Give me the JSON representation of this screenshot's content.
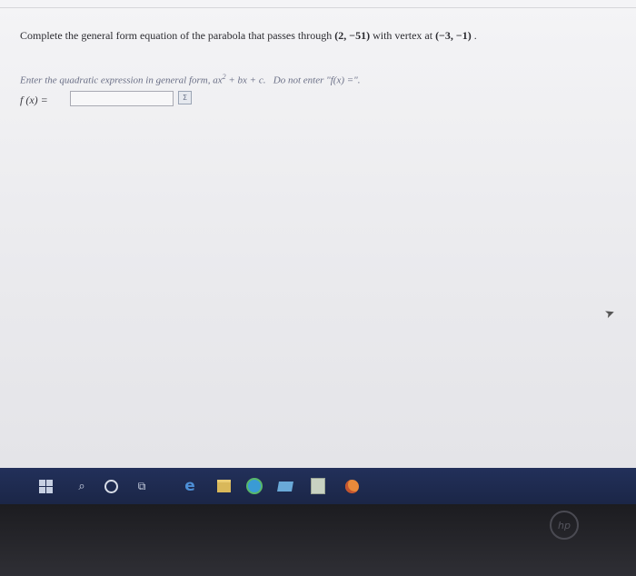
{
  "question": {
    "prefix": "Complete the general form equation of the parabola that passes through",
    "point": "(2, −51)",
    "middle": "with vertex at",
    "vertex": "(−3, −1)",
    "suffix": "."
  },
  "hint": {
    "prefix": "Enter the quadratic expression in general form,",
    "form_a": "ax",
    "exponent": "2",
    "form_rest": "+ bx + c.",
    "note": "Do not enter \"f(x) =\"."
  },
  "answer": {
    "label": "f (x)  =",
    "value": "",
    "sigma_icon": "Σ"
  },
  "taskbar": {
    "icons": [
      "windows-start-icon",
      "search-icon",
      "cortana-icon",
      "task-view-icon",
      "edge-icon",
      "file-explorer-icon",
      "chrome-icon",
      "store-icon",
      "calculator-icon",
      "firefox-icon"
    ],
    "background": "#1f2b52"
  },
  "bezel": {
    "logo": "hp"
  }
}
